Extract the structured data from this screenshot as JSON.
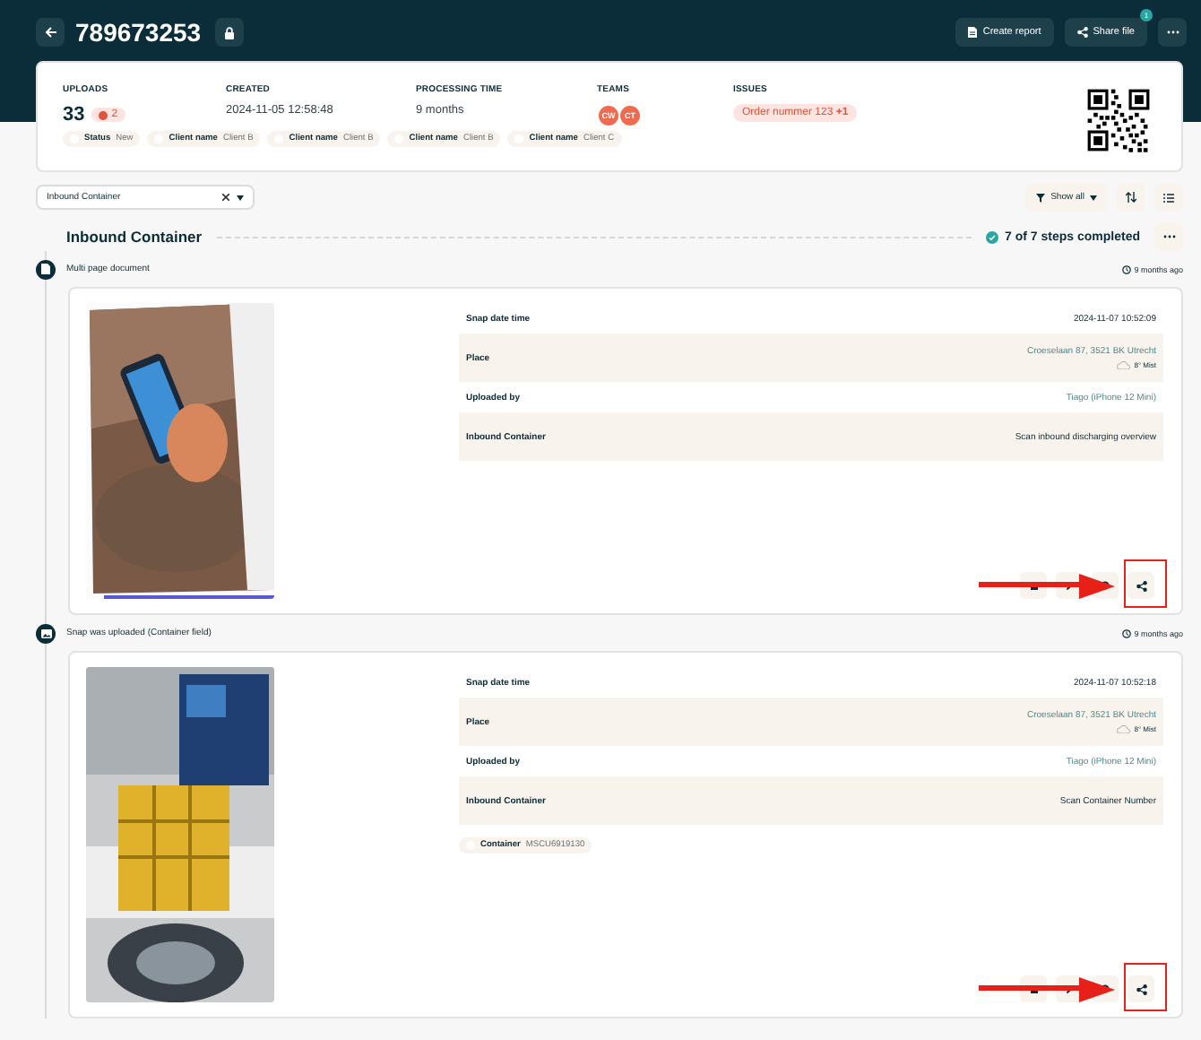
{
  "header": {
    "title": "789673253",
    "buttons": [
      {
        "label": "Create report",
        "kind": "report"
      },
      {
        "label": "Share file",
        "kind": "share",
        "badge": "1"
      }
    ]
  },
  "summary": {
    "fields": [
      {
        "label": "UPLOADS",
        "kind": "count",
        "value": "33",
        "badge": "2"
      },
      {
        "label": "CREATED",
        "kind": "text",
        "value": "2024-11-05 12:58:48"
      },
      {
        "label": "PROCESSING TIME",
        "kind": "text",
        "value": "9 months"
      },
      {
        "label": "TEAMS",
        "kind": "teams",
        "avatars": [
          "CW",
          "CT"
        ]
      },
      {
        "label": "ISSUES",
        "kind": "issue",
        "value": "Order nummer 123 **+1**"
      }
    ],
    "tags": [
      {
        "label": "Status",
        "value": "New"
      },
      {
        "label": "Client name",
        "value": "Client B"
      },
      {
        "label": "Client name",
        "value": "Client B"
      },
      {
        "label": "Client name",
        "value": "Client B"
      },
      {
        "label": "Client name",
        "value": "Client C"
      }
    ]
  },
  "toolbar": {
    "filter": {
      "value": "Inbound Container"
    },
    "show_all": "Show all"
  },
  "section": {
    "title": "Inbound Container",
    "progress": "7 of 7 steps completed"
  },
  "steps": [
    {
      "kind": "document",
      "label": "Multi page document",
      "time": "9 months ago",
      "annotated": true,
      "details": [
        {
          "label": "Snap date time",
          "kind": "plain",
          "value": "2024-11-07 10:52:09"
        },
        {
          "label": "Place",
          "kind": "link",
          "value": "Croeselaan 87, 3521 BK Utrecht",
          "weather": "8° Mist"
        },
        {
          "label": "Uploaded by",
          "kind": "link",
          "value": "Tiago (iPhone 12 Mini)"
        },
        {
          "label": "Inbound Container",
          "kind": "plain",
          "value": "Scan inbound discharging overview"
        }
      ]
    },
    {
      "label": "Snap was uploaded (Container field)",
      "time": "9 months ago",
      "annotated": true,
      "details": [
        {
          "label": "Snap date time",
          "kind": "plain",
          "value": "2024-11-07 10:52:18"
        },
        {
          "label": "Place",
          "kind": "link",
          "value": "Croeselaan 87, 3521 BK Utrecht",
          "weather": "8° Mist"
        },
        {
          "label": "Uploaded by",
          "kind": "link",
          "value": "Tiago (iPhone 12 Mini)"
        },
        {
          "label": "Inbound Container",
          "kind": "plain",
          "value": "Scan Container Number"
        }
      ],
      "tags": [
        {
          "label": "Container",
          "value": "MSCU6919130"
        }
      ]
    }
  ]
}
